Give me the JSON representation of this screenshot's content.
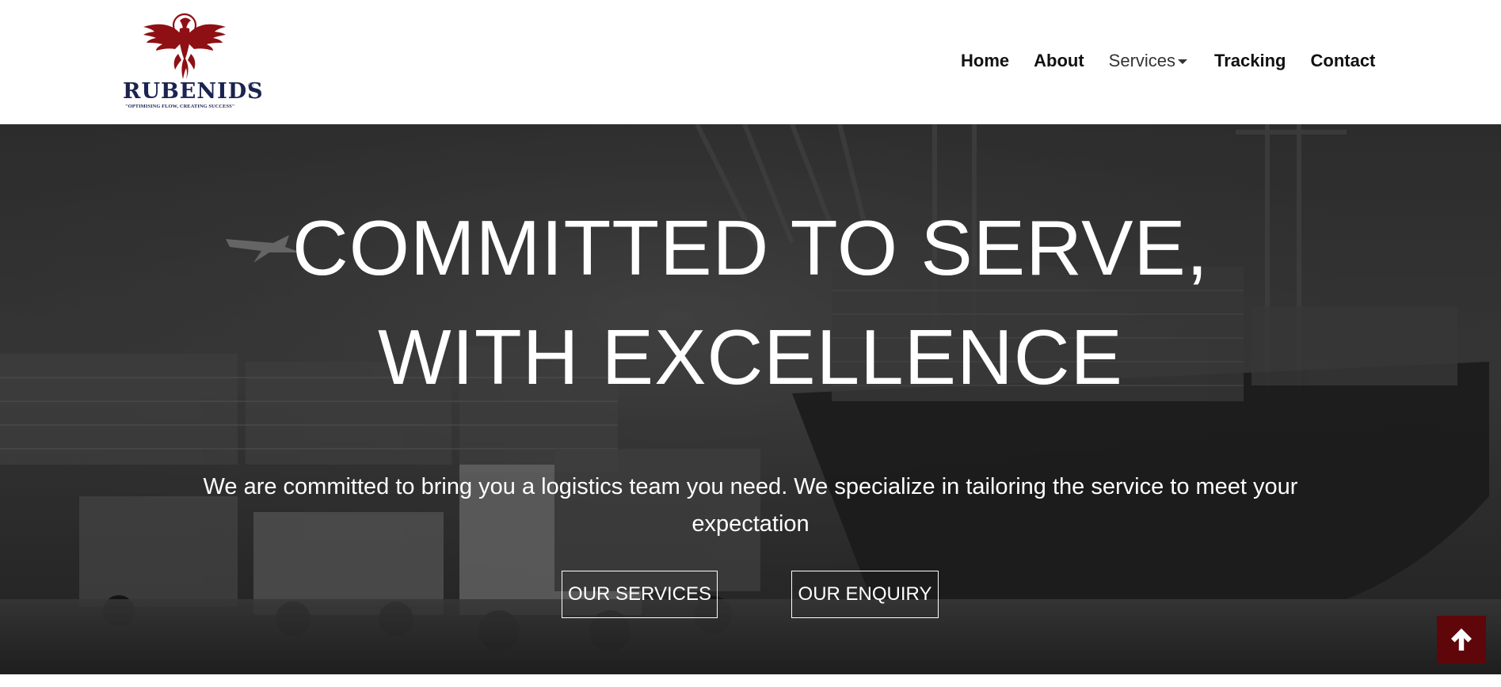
{
  "brand": {
    "name": "RUBENIDS",
    "registered_mark": "®",
    "tagline": "\"OPTIMISING FLOW, CREATING SUCCESS\"",
    "bird_color": "#8e1014",
    "text_color": "#1b2350"
  },
  "nav": {
    "items": [
      {
        "label": "Home"
      },
      {
        "label": "About"
      },
      {
        "label": "Services",
        "has_dropdown": true
      },
      {
        "label": "Tracking"
      },
      {
        "label": "Contact"
      }
    ]
  },
  "hero": {
    "title_line1": "COMMITTED TO SERVE,",
    "title_line2": "WITH EXCELLENCE",
    "description": "We are committed to bring you a logistics team you need. We specialize in tailoring the service to meet your expectation",
    "buttons": {
      "services": "OUR SERVICES",
      "enquiry": "OUR ENQUIRY"
    },
    "background": "grayscale port, container ship and trucks"
  },
  "scroll_top": {
    "icon": "arrow-up-icon",
    "background": "#5e0609"
  }
}
